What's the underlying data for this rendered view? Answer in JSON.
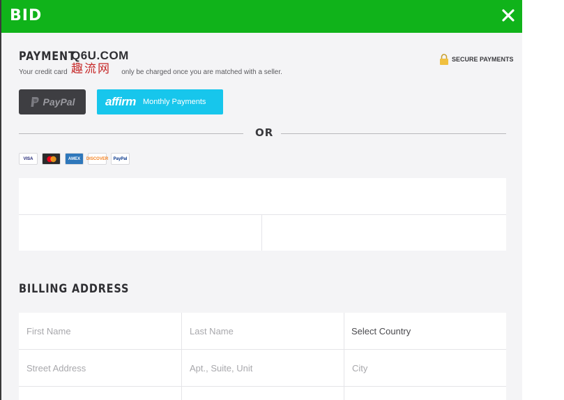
{
  "modal": {
    "title": "BID",
    "close_glyph": "✕"
  },
  "payment": {
    "heading": "PAYMENT",
    "note_before": "Your credit card",
    "note_after": "only be charged once you are matched with a seller.",
    "secure_label": "SECURE PAYMENTS",
    "paypal_label": "PayPal",
    "affirm_brand": "affirm",
    "affirm_label": "Monthly Payments",
    "or_label": "OR",
    "cards": [
      {
        "name": "VISA",
        "bg": "#ffffff",
        "fg": "#1a1f71"
      },
      {
        "name": "MC",
        "bg": "#2b2b2b",
        "fg": "#ff9a00"
      },
      {
        "name": "AMEX",
        "bg": "#2e77bb",
        "fg": "#ffffff"
      },
      {
        "name": "DISCOVER",
        "bg": "#ffffff",
        "fg": "#f58220"
      },
      {
        "name": "PayPal",
        "bg": "#ffffff",
        "fg": "#003087"
      }
    ]
  },
  "billing": {
    "heading": "BILLING ADDRESS",
    "first_name_placeholder": "First Name",
    "last_name_placeholder": "Last Name",
    "country_label": "Select Country",
    "street_placeholder": "Street Address",
    "apt_placeholder": "Apt., Suite, Unit",
    "city_placeholder": "City"
  },
  "watermark": {
    "top": "Q6U.COM",
    "bottom": "趣流网"
  },
  "colors": {
    "header": "#10b31a",
    "affirm": "#17c6ec",
    "paypal_button": "#3e3e42",
    "lock": "#f0c040"
  }
}
